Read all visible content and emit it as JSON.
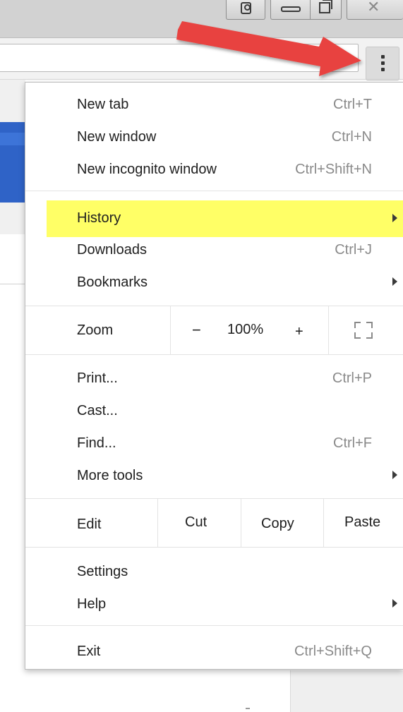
{
  "window_controls": [
    "profile-icon",
    "minimize-icon",
    "restore-icon",
    "close-icon"
  ],
  "toolbar": {
    "bookmark_icon": "star-icon",
    "menu_button_icon": "three-dot-menu-icon"
  },
  "annotation": {
    "arrow_color": "#e8433f",
    "highlight_color": "#ffff66"
  },
  "menu": {
    "new_tab": {
      "label": "New tab",
      "shortcut": "Ctrl+T"
    },
    "new_window": {
      "label": "New window",
      "shortcut": "Ctrl+N"
    },
    "new_incognito": {
      "label": "New incognito window",
      "shortcut": "Ctrl+Shift+N"
    },
    "history": {
      "label": "History"
    },
    "downloads": {
      "label": "Downloads",
      "shortcut": "Ctrl+J"
    },
    "bookmarks": {
      "label": "Bookmarks"
    },
    "zoom": {
      "label": "Zoom",
      "minus": "−",
      "value": "100%",
      "plus": "+"
    },
    "print": {
      "label": "Print...",
      "shortcut": "Ctrl+P"
    },
    "cast": {
      "label": "Cast..."
    },
    "find": {
      "label": "Find...",
      "shortcut": "Ctrl+F"
    },
    "more_tools": {
      "label": "More tools"
    },
    "edit": {
      "label": "Edit",
      "cut": "Cut",
      "copy": "Copy",
      "paste": "Paste"
    },
    "settings": {
      "label": "Settings"
    },
    "help": {
      "label": "Help"
    },
    "exit": {
      "label": "Exit",
      "shortcut": "Ctrl+Shift+Q"
    }
  }
}
